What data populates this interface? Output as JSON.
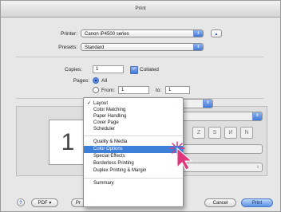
{
  "window": {
    "title": "Print"
  },
  "printer": {
    "label": "Printer:",
    "value": "Canon iP4500 series"
  },
  "presets": {
    "label": "Presets:",
    "value": "Standard"
  },
  "copies": {
    "label": "Copies:",
    "value": "1",
    "collated_label": "Collated"
  },
  "pages": {
    "label": "Pages:",
    "all_label": "All",
    "from_label": "From:",
    "from_value": "1",
    "to_label": "to:",
    "to_value": "1"
  },
  "preview": {
    "page_number": "1"
  },
  "menu": {
    "items": [
      {
        "label": "Layout",
        "checked": true
      },
      {
        "label": "Color Matching"
      },
      {
        "label": "Paper Handling"
      },
      {
        "label": "Cover Page"
      },
      {
        "label": "Scheduler"
      },
      {
        "label": "Quality & Media"
      },
      {
        "label": "Color Options",
        "selected": true
      },
      {
        "label": "Special Effects"
      },
      {
        "label": "Borderless Printing"
      },
      {
        "label": "Duplex Printing & Margin"
      },
      {
        "label": "Summary"
      }
    ],
    "check_glyph": "✓"
  },
  "footer": {
    "help": "?",
    "pdf_label": "PDF ▾",
    "preview_label": "Pr",
    "cancel_label": "Cancel",
    "print_label": "Print"
  },
  "colors": {
    "accent": "#3d7fd9",
    "pointer": "#e0357b"
  }
}
